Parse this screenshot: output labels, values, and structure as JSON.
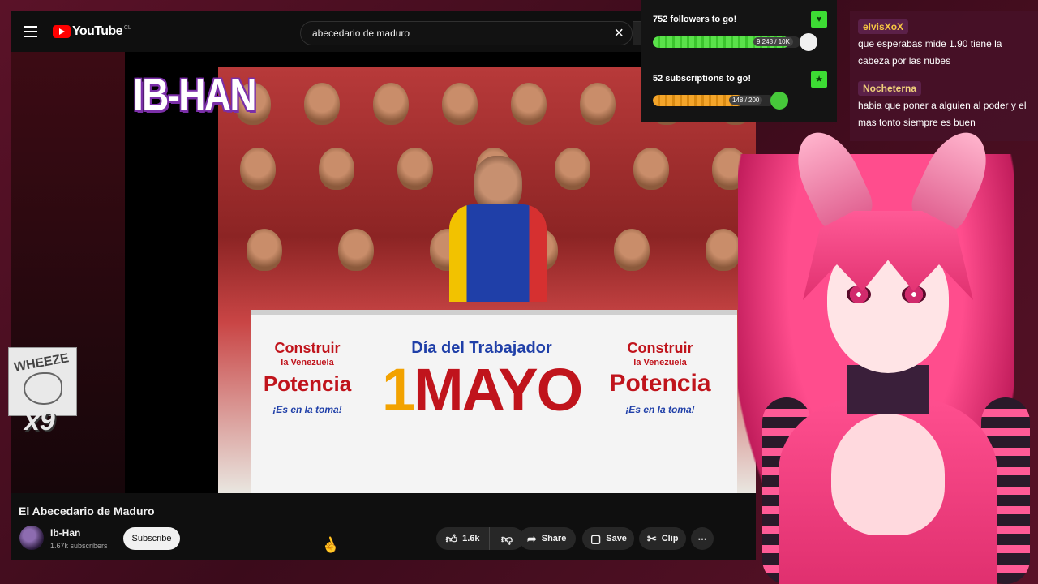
{
  "youtube": {
    "logo_text": "YouTube",
    "logo_region": "CL",
    "search": {
      "query": "abecedario de maduro"
    },
    "video": {
      "watermark": "IB-HAN",
      "banner": {
        "left_top": "Construir",
        "left_small": "la Venezuela",
        "left_big": "Potencia",
        "left_tag": "¡Es en la toma!",
        "mid_dia": "Día del Trabajador",
        "mid_number": "1",
        "mid_mayo": "MAYO",
        "right_top": "Construir",
        "right_small": "la Venezuela",
        "right_big": "Potencia",
        "right_tag": "¡Es en la toma!"
      }
    },
    "title": "El Abecedario de Maduro",
    "channel": {
      "name": "Ib-Han",
      "subscribers": "1.67k subscribers",
      "subscribe_label": "Subscribe"
    },
    "actions": {
      "likes": "1.6k",
      "share": "Share",
      "save": "Save",
      "clip": "Clip",
      "more": "⋯"
    }
  },
  "overlay": {
    "wheeze": {
      "label": "WHEEZE",
      "count": "x9"
    },
    "goals": [
      {
        "title": "752 followers to go!",
        "count": "9,248 / 10K",
        "progress": 0.9248
      },
      {
        "title": "52 subscriptions to go!",
        "count": "148 / 200",
        "progress": 0.74
      }
    ],
    "chat": [
      {
        "user": "elvisXoX",
        "text": "que esperabas mide 1.90 tiene la cabeza por las nubes"
      },
      {
        "user": "Nocheterna",
        "text": "habia que poner a alguien al poder y el mas tonto siempre es buen"
      }
    ]
  },
  "colors": {
    "youtube_red": "#ff0000",
    "goal_green": "#3ddc34",
    "goal_orange": "#f4a52a",
    "vtuber_pink": "#ff4d8d"
  }
}
